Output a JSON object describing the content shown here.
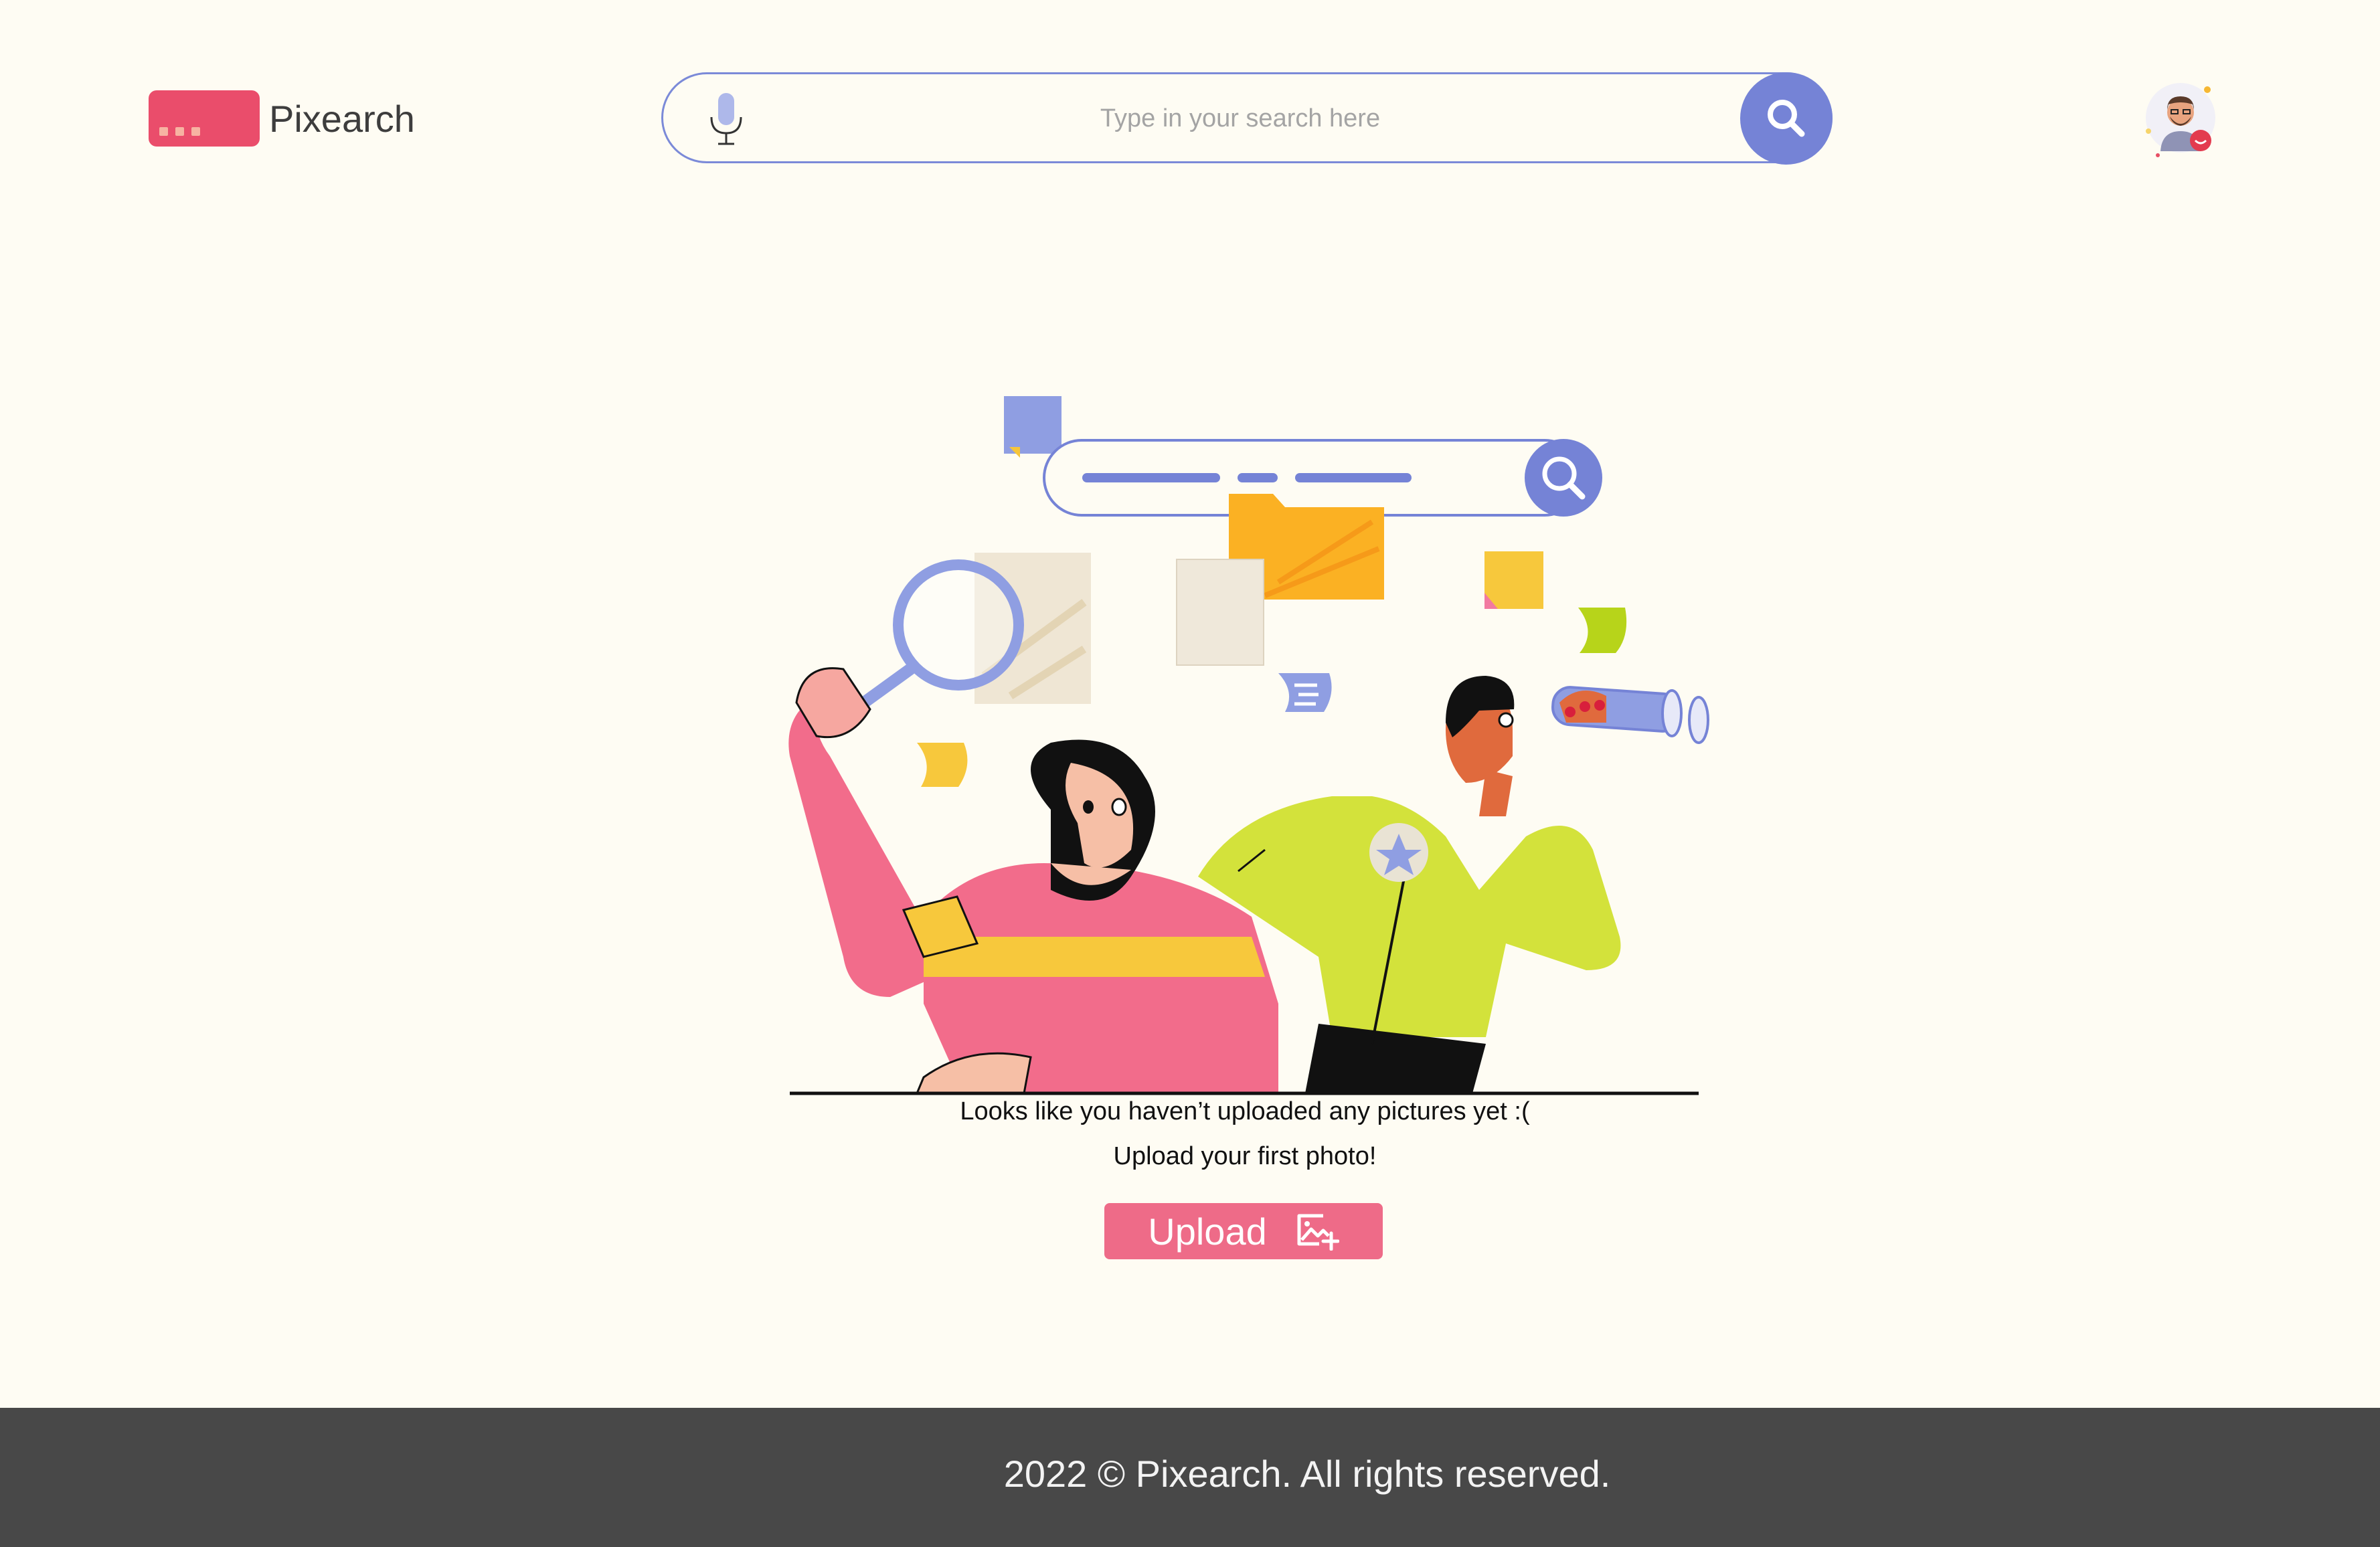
{
  "brand": {
    "name": "Pixearch",
    "color": "#ea4d6b"
  },
  "search": {
    "placeholder": "Type in your search here",
    "value": "",
    "accent": "#7583d6"
  },
  "icons": {
    "mic": "microphone-icon",
    "search": "magnifier-icon",
    "upload": "image-add-icon",
    "avatar": "user-avatar"
  },
  "empty_state": {
    "message": "Looks like you haven’t uploaded any pictures yet :(",
    "prompt": "Upload your first photo!",
    "button_label": "Upload",
    "button_color": "#ee6b88"
  },
  "footer": {
    "text": "2022 © Pixearch. All rights reserved.",
    "background": "#484848"
  }
}
